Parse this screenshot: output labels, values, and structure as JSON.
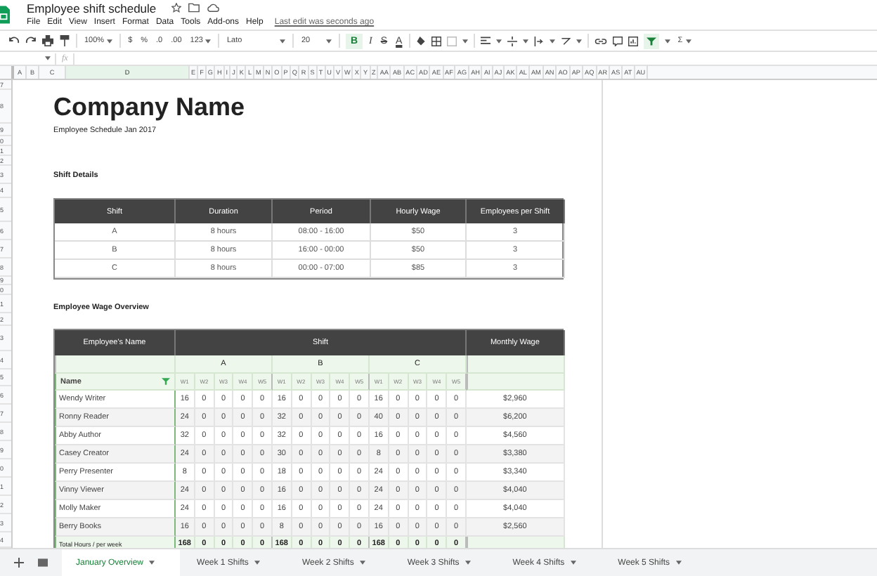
{
  "title": "Employee shift schedule",
  "menu": [
    "File",
    "Edit",
    "View",
    "Insert",
    "Format",
    "Data",
    "Tools",
    "Add-ons",
    "Help"
  ],
  "last_edit": "Last edit was seconds ago",
  "toolbar": {
    "zoom": "100%",
    "currency": "$",
    "percent": "%",
    "decimal_less": ".0",
    "decimal_more": ".00",
    "number_format": "123",
    "font": "Lato",
    "font_size": "20",
    "bold": {
      "label": "B",
      "selected": true
    },
    "italic": "I",
    "strike": "S",
    "text_color": "A",
    "filter_on": true,
    "sum": "Σ"
  },
  "formula_bar": {
    "fx": "fx"
  },
  "columns": [
    {
      "label": "A",
      "selected": false
    },
    {
      "label": "B",
      "selected": false
    },
    {
      "label": "C",
      "selected": false
    },
    {
      "label": "D",
      "selected": true
    },
    {
      "label": "E",
      "selected": false
    },
    {
      "label": "F",
      "selected": false
    },
    {
      "label": "G",
      "selected": false
    },
    {
      "label": "H",
      "selected": false
    },
    {
      "label": "I",
      "selected": false
    },
    {
      "label": "J",
      "selected": false
    },
    {
      "label": "K",
      "selected": false
    },
    {
      "label": "L",
      "selected": false
    },
    {
      "label": "M",
      "selected": false
    },
    {
      "label": "N",
      "selected": false
    },
    {
      "label": "O",
      "selected": false
    },
    {
      "label": "P",
      "selected": false
    },
    {
      "label": "Q",
      "selected": false
    },
    {
      "label": "R",
      "selected": false
    },
    {
      "label": "S",
      "selected": false
    },
    {
      "label": "T",
      "selected": false
    },
    {
      "label": "U",
      "selected": false
    },
    {
      "label": "V",
      "selected": false
    },
    {
      "label": "W",
      "selected": false
    },
    {
      "label": "X",
      "selected": false
    },
    {
      "label": "Y",
      "selected": false
    },
    {
      "label": "Z",
      "selected": false
    },
    {
      "label": "AA",
      "selected": false
    },
    {
      "label": "AB",
      "selected": false
    },
    {
      "label": "AC",
      "selected": false
    },
    {
      "label": "AD",
      "selected": false
    },
    {
      "label": "AE",
      "selected": false
    },
    {
      "label": "AF",
      "selected": false
    },
    {
      "label": "AG",
      "selected": false
    },
    {
      "label": "AH",
      "selected": false
    },
    {
      "label": "AI",
      "selected": false
    },
    {
      "label": "AJ",
      "selected": false
    },
    {
      "label": "AK",
      "selected": false
    },
    {
      "label": "AL",
      "selected": false
    },
    {
      "label": "AM",
      "selected": false
    },
    {
      "label": "AN",
      "selected": false
    },
    {
      "label": "AO",
      "selected": false
    },
    {
      "label": "AP",
      "selected": false
    },
    {
      "label": "AQ",
      "selected": false
    },
    {
      "label": "AR",
      "selected": false
    },
    {
      "label": "AS",
      "selected": false
    },
    {
      "label": "AT",
      "selected": false
    },
    {
      "label": "AU",
      "selected": false
    }
  ],
  "row_numbers": [
    "7",
    "8",
    "9",
    "0",
    "1",
    "2",
    "3",
    "4",
    "5",
    "6",
    "7",
    "8",
    "9",
    "0",
    "1",
    "2",
    "3",
    "4",
    "5",
    "6",
    "7",
    "8",
    "9",
    "0",
    "1",
    "2",
    "3",
    "4"
  ],
  "company": "Company Name",
  "subtitle": "Employee Schedule Jan 2017",
  "shift_details": {
    "heading": "Shift Details",
    "columns": [
      "Shift",
      "Duration",
      "Period",
      "Hourly Wage",
      "Employees per Shift"
    ],
    "rows": [
      [
        "A",
        "8 hours",
        "08:00 - 16:00",
        "$50",
        "3"
      ],
      [
        "B",
        "8 hours",
        "16:00 - 00:00",
        "$50",
        "3"
      ],
      [
        "C",
        "8 hours",
        "00:00 - 07:00",
        "$85",
        "3"
      ]
    ]
  },
  "wage_overview": {
    "heading": "Employee Wage Overview",
    "columns": [
      "Employee's Name",
      "Shift",
      "Monthly Wage"
    ],
    "groups": [
      "A",
      "B",
      "C"
    ],
    "name_header": "Name",
    "weeks": [
      "W1",
      "W2",
      "W3",
      "W4",
      "W5",
      "W1",
      "W2",
      "W3",
      "W4",
      "W5",
      "W1",
      "W2",
      "W3",
      "W4",
      "W5"
    ],
    "rows": [
      {
        "name": "Wendy Writer",
        "hours": [
          "16",
          "0",
          "0",
          "0",
          "0",
          "16",
          "0",
          "0",
          "0",
          "0",
          "16",
          "0",
          "0",
          "0",
          "0"
        ],
        "wage": "$2,960"
      },
      {
        "name": "Ronny Reader",
        "hours": [
          "24",
          "0",
          "0",
          "0",
          "0",
          "32",
          "0",
          "0",
          "0",
          "0",
          "40",
          "0",
          "0",
          "0",
          "0"
        ],
        "wage": "$6,200"
      },
      {
        "name": "Abby Author",
        "hours": [
          "32",
          "0",
          "0",
          "0",
          "0",
          "32",
          "0",
          "0",
          "0",
          "0",
          "16",
          "0",
          "0",
          "0",
          "0"
        ],
        "wage": "$4,560"
      },
      {
        "name": "Casey Creator",
        "hours": [
          "24",
          "0",
          "0",
          "0",
          "0",
          "30",
          "0",
          "0",
          "0",
          "0",
          "8",
          "0",
          "0",
          "0",
          "0"
        ],
        "wage": "$3,380"
      },
      {
        "name": "Perry Presenter",
        "hours": [
          "8",
          "0",
          "0",
          "0",
          "0",
          "18",
          "0",
          "0",
          "0",
          "0",
          "24",
          "0",
          "0",
          "0",
          "0"
        ],
        "wage": "$3,340"
      },
      {
        "name": "Vinny Viewer",
        "hours": [
          "24",
          "0",
          "0",
          "0",
          "0",
          "16",
          "0",
          "0",
          "0",
          "0",
          "24",
          "0",
          "0",
          "0",
          "0"
        ],
        "wage": "$4,040"
      },
      {
        "name": "Molly Maker",
        "hours": [
          "24",
          "0",
          "0",
          "0",
          "0",
          "16",
          "0",
          "0",
          "0",
          "0",
          "24",
          "0",
          "0",
          "0",
          "0"
        ],
        "wage": "$4,040"
      },
      {
        "name": "Berry Books",
        "hours": [
          "16",
          "0",
          "0",
          "0",
          "0",
          "8",
          "0",
          "0",
          "0",
          "0",
          "16",
          "0",
          "0",
          "0",
          "0"
        ],
        "wage": "$2,560"
      }
    ],
    "total": {
      "label": "Total Hours / per week",
      "hours": [
        "168",
        "0",
        "0",
        "0",
        "0",
        "168",
        "0",
        "0",
        "0",
        "0",
        "168",
        "0",
        "0",
        "0",
        "0"
      ]
    }
  },
  "sheet_tabs": [
    {
      "label": "January Overview",
      "selected": true
    },
    {
      "label": "Week 1 Shifts",
      "selected": false
    },
    {
      "label": "Week 2 Shifts",
      "selected": false
    },
    {
      "label": "Week 3 Shifts",
      "selected": false
    },
    {
      "label": "Week 4 Shifts",
      "selected": false
    },
    {
      "label": "Week 5 Shifts",
      "selected": false
    }
  ]
}
